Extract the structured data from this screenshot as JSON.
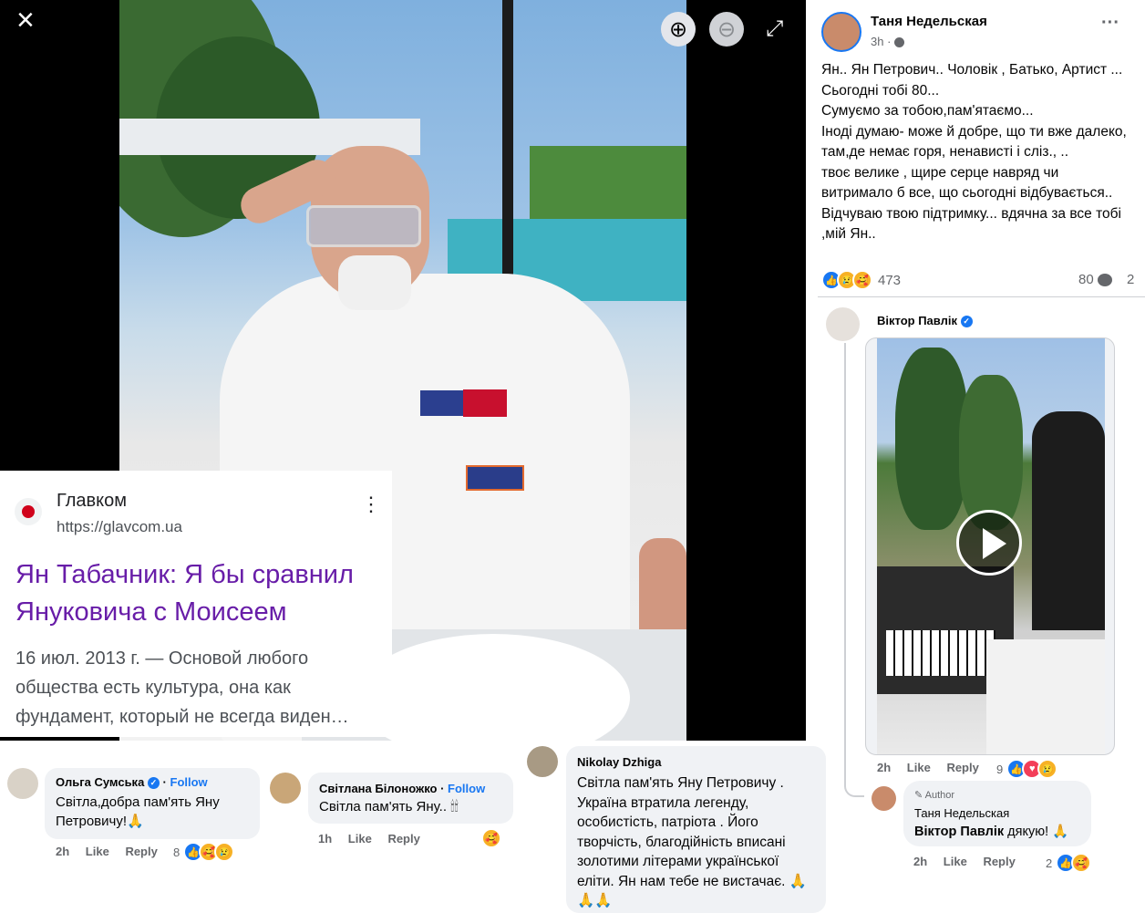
{
  "viewer": {
    "close_icon": "×",
    "zoom_in_icon": "⊕",
    "zoom_out_icon": "⊖",
    "expand_icon": "⤢"
  },
  "google_card": {
    "site_name": "Главком",
    "url": "https://glavcom.ua",
    "title": "Ян Табачник: Я бы сравнил Януковича с Моисеем",
    "snippet": "16 июл. 2013 г. — Основой любого общества есть культура, она как фундамент, который не всегда виден…",
    "menu_icon": "⋮"
  },
  "post": {
    "author": "Таня Недельская",
    "time": "3h ·",
    "text": "Ян.. Ян Петрович.. Чоловік , Батько, Артист ...\nСьогодні тобі 80...\nСумуємо за тобою,пам'ятаємо...\nІноді думаю- може й добре, що ти вже далеко,\nтам,де немає горя, ненависті і сліз., ..\nтвоє велике , щире серце навряд чи\nвитримало б все, що сьогодні відбувається..\nВідчуваю твою підтримку... вдячна за все тобі\n,мій Ян..",
    "more_icon": "···",
    "reactions_count": "473",
    "comments_count": "80",
    "shares_count": "2"
  },
  "comment_pavlik": {
    "author": "Віктор Павлік",
    "time": "2h",
    "like": "Like",
    "reply": "Reply",
    "reactions_count": "9"
  },
  "reply_tanya": {
    "badge": "Author",
    "author": "Таня Недельская",
    "mention": "Віктор Павлік",
    "text": " дякую!",
    "emoji": "🙏",
    "time": "2h",
    "like": "Like",
    "reply": "Reply",
    "reactions_count": "2"
  },
  "comment_olga": {
    "author": "Ольга Сумська",
    "follow": "Follow",
    "text": "Світла,добра пам'ять Яну Петровичу!",
    "emoji": "🙏",
    "time": "2h",
    "like": "Like",
    "reply": "Reply",
    "reactions_count": "8"
  },
  "comment_svitlana": {
    "author": "Світлана Білоножко ·",
    "follow": "Follow",
    "text": "Світла пам'ять Яну..",
    "emoji": "🕯🕯",
    "time": "1h",
    "like": "Like",
    "reply": "Reply"
  },
  "comment_nikolay": {
    "author": "Nikolay Dzhiga",
    "text": "Світла пам'ять Яну Петровичу . Україна втратила легенду, особистість, патріота . Його творчість, благодійність вписані золотими літерами української еліти. Ян нам тебе не вистачає.",
    "emoji": "🙏",
    "emoji2": "🙏🙏"
  },
  "colors": {
    "fb_blue": "#1877f2",
    "google_link": "#681da8",
    "bubble": "#f0f2f5"
  }
}
